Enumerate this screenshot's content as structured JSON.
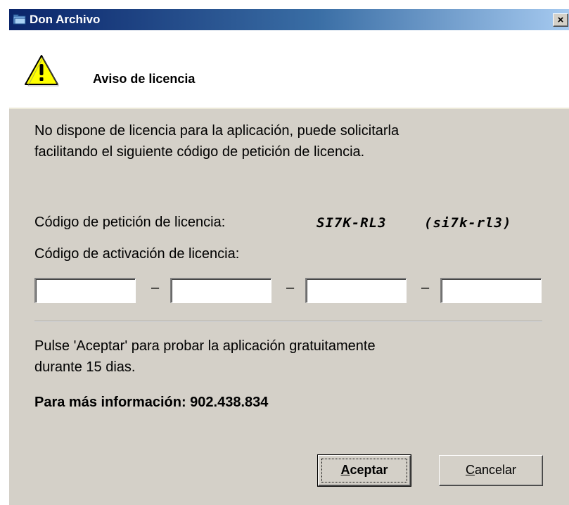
{
  "window": {
    "title": "Don Archivo",
    "close_symbol": "×"
  },
  "header": {
    "title": "Aviso de licencia",
    "icon": "warning-icon"
  },
  "body": {
    "intro_line1": "No dispone de licencia para la aplicación, puede solicitarla",
    "intro_line2": "facilitando el siguiente código de petición de licencia.",
    "request_label": "Código de petición de licencia:",
    "request_code": "SI7K-RL3",
    "request_code_alt": "(si7k-rl3)",
    "activation_label": "Código de activación de licencia:",
    "activation_fields": [
      "",
      "",
      "",
      ""
    ],
    "dash": "–",
    "trial_line1": "Pulse 'Aceptar' para probar la aplicación gratuitamente",
    "trial_line2": "durante 15 dias.",
    "info": "Para más información: 902.438.834"
  },
  "buttons": {
    "accept_mnemonic": "A",
    "accept_rest": "ceptar",
    "cancel_mnemonic": "C",
    "cancel_rest": "ancelar"
  },
  "colors": {
    "titlebar_start": "#0a246a",
    "titlebar_end": "#a6caf0",
    "dialog_bg": "#d4d0c8",
    "warning_yellow": "#ffff00"
  }
}
